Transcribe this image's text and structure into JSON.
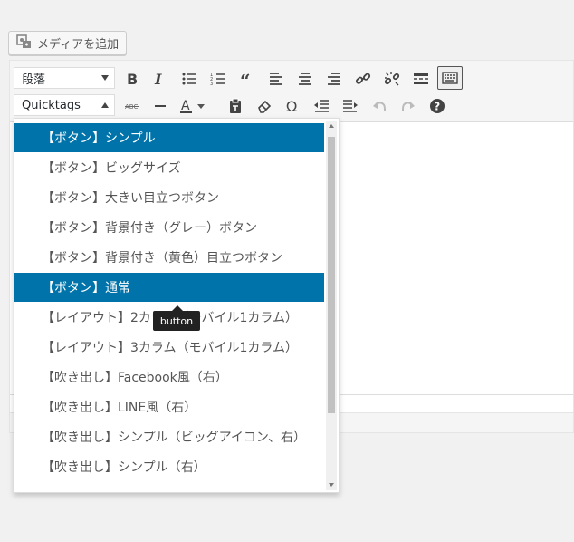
{
  "media_button": {
    "label": "メディアを追加",
    "icon": "media-add-icon"
  },
  "format_select": {
    "value": "段落"
  },
  "quicktags_select": {
    "value": "Quicktags"
  },
  "toolbar_row1": [
    {
      "name": "bold-icon"
    },
    {
      "name": "italic-icon"
    },
    {
      "name": "bullet-list-icon"
    },
    {
      "name": "numbered-list-icon"
    },
    {
      "name": "blockquote-icon"
    },
    {
      "name": "align-left-icon"
    },
    {
      "name": "align-center-icon"
    },
    {
      "name": "align-right-icon"
    },
    {
      "name": "link-icon"
    },
    {
      "name": "unlink-icon"
    },
    {
      "name": "read-more-icon"
    },
    {
      "name": "toolbar-toggle-icon"
    }
  ],
  "toolbar_row2": [
    {
      "name": "strikethrough-icon"
    },
    {
      "name": "horizontal-line-icon"
    },
    {
      "name": "text-color-icon"
    },
    {
      "name": "paste-text-icon"
    },
    {
      "name": "clear-format-icon"
    },
    {
      "name": "special-character-icon"
    },
    {
      "name": "outdent-icon"
    },
    {
      "name": "indent-icon"
    },
    {
      "name": "undo-icon"
    },
    {
      "name": "redo-icon"
    },
    {
      "name": "help-icon"
    }
  ],
  "menu": {
    "items": [
      {
        "label": "【ボタン】シンプル",
        "selected": true
      },
      {
        "label": "【ボタン】ビッグサイズ",
        "selected": false
      },
      {
        "label": "【ボタン】大きい目立つボタン",
        "selected": false
      },
      {
        "label": "【ボタン】背景付き（グレー）ボタン",
        "selected": false
      },
      {
        "label": "【ボタン】背景付き（黄色）目立つボタン",
        "selected": false
      },
      {
        "label": "【ボタン】通常",
        "selected": true
      },
      {
        "label": "【レイアウト】2カラム（モバイル1カラム）",
        "selected": false
      },
      {
        "label": "【レイアウト】3カラム（モバイル1カラム）",
        "selected": false
      },
      {
        "label": "【吹き出し】Facebook風（右）",
        "selected": false
      },
      {
        "label": "【吹き出し】LINE風（右）",
        "selected": false
      },
      {
        "label": "【吹き出し】シンプル（ビッグアイコン、右）",
        "selected": false
      },
      {
        "label": "【吹き出し】シンプル（右）",
        "selected": false
      }
    ]
  },
  "tooltip": {
    "text": "button"
  },
  "colors": {
    "selected_bg": "#0073aa",
    "tooltip_bg": "#222222"
  }
}
